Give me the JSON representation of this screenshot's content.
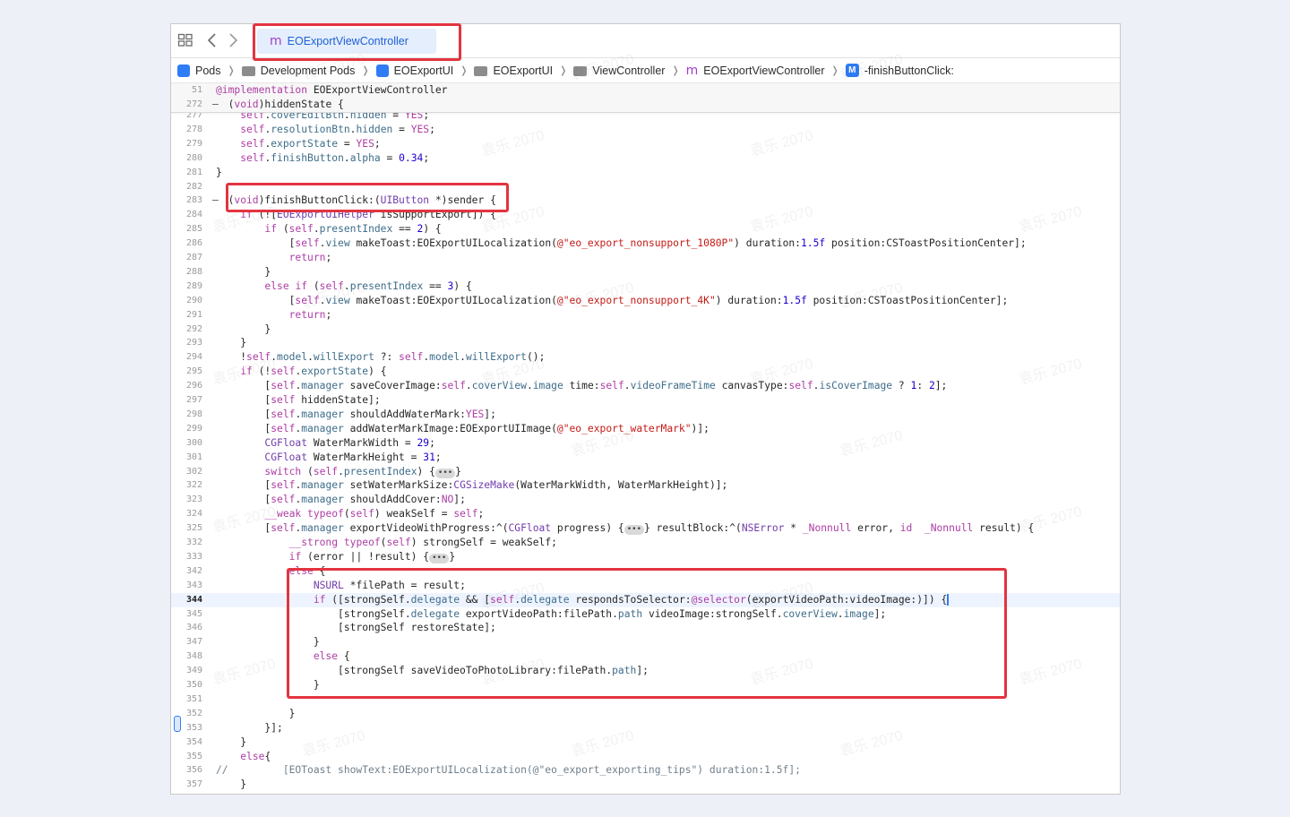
{
  "tab": {
    "icon": "m",
    "title": "EOExportViewController"
  },
  "breadcrumbs": [
    {
      "icon": "app-icon",
      "label": "Pods"
    },
    {
      "icon": "folder-icon",
      "label": "Development Pods"
    },
    {
      "icon": "app-icon",
      "label": "EOExportUI"
    },
    {
      "icon": "folder-icon",
      "label": "EOExportUI"
    },
    {
      "icon": "folder-icon",
      "label": "ViewController"
    },
    {
      "icon": "class-m-icon",
      "label": "EOExportViewController"
    },
    {
      "icon": "method-M-icon",
      "label": "-finishButtonClick:"
    }
  ],
  "watermark": "袁乐 2070",
  "sticky_lines": [
    {
      "n": "51",
      "t": "@implementation EOExportViewController"
    },
    {
      "n": "272",
      "t": "- (void)hiddenState {"
    }
  ],
  "lines": [
    {
      "n": "277",
      "t": "    self.coverEditBtn.hidden = YES;"
    },
    {
      "n": "278",
      "t": "    self.resolutionBtn.hidden = YES;"
    },
    {
      "n": "279",
      "t": "    self.exportState = YES;"
    },
    {
      "n": "280",
      "t": "    self.finishButton.alpha = 0.34;"
    },
    {
      "n": "281",
      "t": "}"
    },
    {
      "n": "282",
      "t": ""
    },
    {
      "n": "283",
      "t": "- (void)finishButtonClick:(UIButton *)sender {"
    },
    {
      "n": "284",
      "t": "    if (![EOExportUIHelper isSupportExport]) {"
    },
    {
      "n": "285",
      "t": "        if (self.presentIndex == 2) {"
    },
    {
      "n": "286",
      "t": "            [self.view makeToast:EOExportUILocalization(@\"eo_export_nonsupport_1080P\") duration:1.5f position:CSToastPositionCenter];"
    },
    {
      "n": "287",
      "t": "            return;"
    },
    {
      "n": "288",
      "t": "        }"
    },
    {
      "n": "289",
      "t": "        else if (self.presentIndex == 3) {"
    },
    {
      "n": "290",
      "t": "            [self.view makeToast:EOExportUILocalization(@\"eo_export_nonsupport_4K\") duration:1.5f position:CSToastPositionCenter];"
    },
    {
      "n": "291",
      "t": "            return;"
    },
    {
      "n": "292",
      "t": "        }"
    },
    {
      "n": "293",
      "t": "    }"
    },
    {
      "n": "294",
      "t": "    !self.model.willExport ?: self.model.willExport();"
    },
    {
      "n": "295",
      "t": "    if (!self.exportState) {"
    },
    {
      "n": "296",
      "t": "        [self.manager saveCoverImage:self.coverView.image time:self.videoFrameTime canvasType:self.isCoverImage ? 1: 2];"
    },
    {
      "n": "297",
      "t": "        [self hiddenState];"
    },
    {
      "n": "298",
      "t": "        [self.manager shouldAddWaterMark:YES];"
    },
    {
      "n": "299",
      "t": "        [self.manager addWaterMarkImage:EOExportUIImage(@\"eo_export_waterMark\")];"
    },
    {
      "n": "300",
      "t": "        CGFloat WaterMarkWidth = 29;"
    },
    {
      "n": "301",
      "t": "        CGFloat WaterMarkHeight = 31;"
    },
    {
      "n": "302",
      "t": "        switch (self.presentIndex) {•••}"
    },
    {
      "n": "322",
      "t": "        [self.manager setWaterMarkSize:CGSizeMake(WaterMarkWidth, WaterMarkHeight)];"
    },
    {
      "n": "323",
      "t": "        [self.manager shouldAddCover:NO];"
    },
    {
      "n": "324",
      "t": "        __weak typeof(self) weakSelf = self;"
    },
    {
      "n": "325",
      "t": "        [self.manager exportVideoWithProgress:^(CGFloat progress) {•••} resultBlock:^(NSError * _Nonnull error, id  _Nonnull result) {"
    },
    {
      "n": "332",
      "t": "            __strong typeof(self) strongSelf = weakSelf;"
    },
    {
      "n": "333",
      "t": "            if (error || !result) {•••}"
    },
    {
      "n": "342",
      "t": "            else {"
    },
    {
      "n": "343",
      "t": "                NSURL *filePath = result;"
    },
    {
      "n": "344",
      "t": "                if ([strongSelf.delegate && [self.delegate respondsToSelector:@selector(exportVideoPath:videoImage:)]) {"
    },
    {
      "n": "345",
      "t": "                    [strongSelf.delegate exportVideoPath:filePath.path videoImage:strongSelf.coverView.image];"
    },
    {
      "n": "346",
      "t": "                    [strongSelf restoreState];"
    },
    {
      "n": "347",
      "t": "                }"
    },
    {
      "n": "348",
      "t": "                else {"
    },
    {
      "n": "349",
      "t": "                    [strongSelf saveVideoToPhotoLibrary:filePath.path];"
    },
    {
      "n": "350",
      "t": "                }"
    },
    {
      "n": "351",
      "t": ""
    },
    {
      "n": "352",
      "t": "            }"
    },
    {
      "n": "353",
      "t": "        }];"
    },
    {
      "n": "354",
      "t": "    }"
    },
    {
      "n": "355",
      "t": "    else{"
    },
    {
      "n": "356",
      "t": "//         [EOToast showText:EOExportUILocalization(@\"eo_export_exporting_tips\") duration:1.5f];"
    },
    {
      "n": "357",
      "t": "    }"
    }
  ],
  "current_line": "344",
  "colors": {
    "accent": "#2f7cf6",
    "highlight": "#e3343f",
    "tab_bg": "#e4eefc"
  }
}
